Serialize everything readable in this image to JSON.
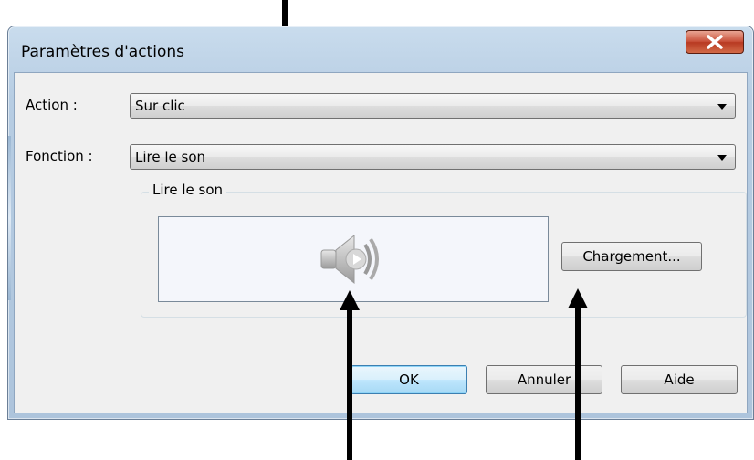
{
  "window": {
    "title": "Paramètres d'actions",
    "close_icon": "close-x-icon"
  },
  "form": {
    "action_label": "Action :",
    "action_value": "Sur clic",
    "function_label": "Fonction :",
    "function_value": "Lire le son"
  },
  "group": {
    "title": "Lire le son",
    "sound_icon": "speaker-icon",
    "load_button": "Chargement..."
  },
  "buttons": {
    "ok": "OK",
    "cancel": "Annuler",
    "help": "Aide"
  },
  "colors": {
    "close_red": "#c9513a",
    "frame_blue": "#b7cde3",
    "default_button": "#3c7fb1"
  }
}
